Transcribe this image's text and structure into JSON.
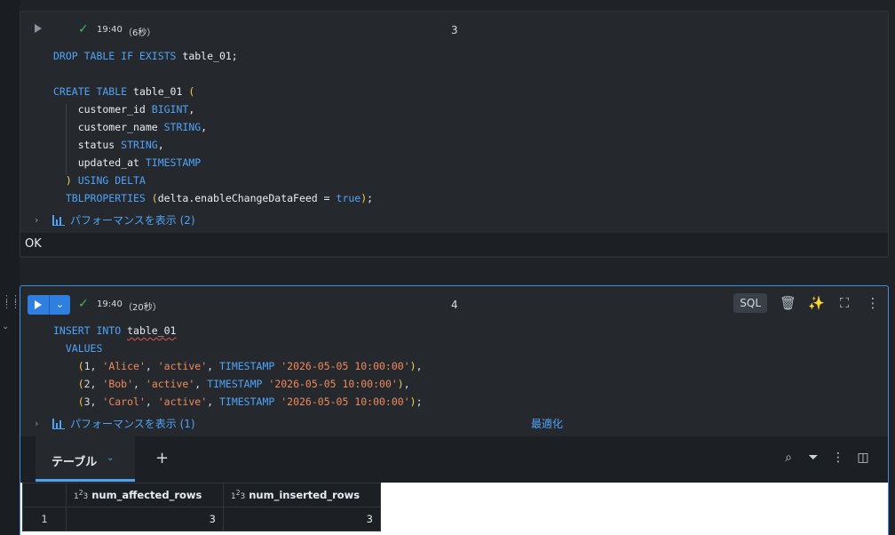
{
  "cell3": {
    "status_time": "19:40",
    "status_duration": "（6秒）",
    "number": "3",
    "code_lines": [
      [
        {
          "t": "kw",
          "v": "DROP TABLE IF EXISTS "
        },
        {
          "t": "id",
          "v": "table_01;"
        }
      ],
      [],
      [
        {
          "t": "kw",
          "v": "CREATE TABLE "
        },
        {
          "t": "id",
          "v": "table_01 "
        },
        {
          "t": "pn",
          "v": "("
        }
      ],
      [
        {
          "t": "id",
          "v": "    customer_id "
        },
        {
          "t": "ty",
          "v": "BIGINT"
        },
        {
          "t": "id",
          "v": ","
        }
      ],
      [
        {
          "t": "id",
          "v": "    customer_name "
        },
        {
          "t": "ty",
          "v": "STRING"
        },
        {
          "t": "id",
          "v": ","
        }
      ],
      [
        {
          "t": "id",
          "v": "    status "
        },
        {
          "t": "ty",
          "v": "STRING"
        },
        {
          "t": "id",
          "v": ","
        }
      ],
      [
        {
          "t": "id",
          "v": "    updated_at "
        },
        {
          "t": "ty",
          "v": "TIMESTAMP"
        }
      ],
      [
        {
          "t": "pn",
          "v": "  ) "
        },
        {
          "t": "kw",
          "v": "USING DELTA"
        }
      ],
      [
        {
          "t": "kw",
          "v": "  TBLPROPERTIES "
        },
        {
          "t": "pn",
          "v": "("
        },
        {
          "t": "id",
          "v": "delta.enableChangeDataFeed = "
        },
        {
          "t": "bo",
          "v": "true"
        },
        {
          "t": "pn",
          "v": ")"
        },
        {
          "t": "id",
          "v": ";"
        }
      ]
    ],
    "perf_label": "パフォーマンスを表示 (2)",
    "result_text": "OK"
  },
  "cell4": {
    "status_time": "19:40",
    "status_duration": "（20秒）",
    "number": "4",
    "lang_label": "SQL",
    "code_lines": [
      [
        {
          "t": "kw",
          "v": "INSERT INTO "
        },
        {
          "t": "sq",
          "v": "table_01"
        }
      ],
      [
        {
          "t": "kw",
          "v": "  VALUES"
        }
      ],
      [
        {
          "t": "pn",
          "v": "    ("
        },
        {
          "t": "nm",
          "v": "1, "
        },
        {
          "t": "st",
          "v": "'Alice'"
        },
        {
          "t": "nm",
          "v": ", "
        },
        {
          "t": "st",
          "v": "'active'"
        },
        {
          "t": "nm",
          "v": ", "
        },
        {
          "t": "kw",
          "v": "TIMESTAMP "
        },
        {
          "t": "st",
          "v": "'2026-05-05 10:00:00'"
        },
        {
          "t": "pn",
          "v": ")"
        },
        {
          "t": "nm",
          "v": ","
        }
      ],
      [
        {
          "t": "pn",
          "v": "    ("
        },
        {
          "t": "nm",
          "v": "2, "
        },
        {
          "t": "st",
          "v": "'Bob'"
        },
        {
          "t": "nm",
          "v": ", "
        },
        {
          "t": "st",
          "v": "'active'"
        },
        {
          "t": "nm",
          "v": ", "
        },
        {
          "t": "kw",
          "v": "TIMESTAMP "
        },
        {
          "t": "st",
          "v": "'2026-05-05 10:00:00'"
        },
        {
          "t": "pn",
          "v": ")"
        },
        {
          "t": "nm",
          "v": ","
        }
      ],
      [
        {
          "t": "pn",
          "v": "    ("
        },
        {
          "t": "nm",
          "v": "3, "
        },
        {
          "t": "st",
          "v": "'Carol'"
        },
        {
          "t": "nm",
          "v": ", "
        },
        {
          "t": "st",
          "v": "'active'"
        },
        {
          "t": "nm",
          "v": ", "
        },
        {
          "t": "kw",
          "v": "TIMESTAMP "
        },
        {
          "t": "st",
          "v": "'2026-05-05 10:00:00'"
        },
        {
          "t": "pn",
          "v": ")"
        },
        {
          "t": "nm",
          "v": ";"
        }
      ]
    ],
    "perf_label": "パフォーマンスを表示 (1)",
    "optimize_label": "最適化",
    "results": {
      "tab_label": "テーブル",
      "type_badge_pre": "1",
      "type_badge_sup": "2",
      "type_badge_post": "3",
      "columns": [
        "num_affected_rows",
        "num_inserted_rows"
      ],
      "rows": [
        {
          "row_num": "1",
          "values": [
            "3",
            "3"
          ]
        }
      ]
    }
  },
  "colors": {
    "accent": "#4fa3f7",
    "success": "#3fb950",
    "run_button": "#2f7fe0"
  }
}
